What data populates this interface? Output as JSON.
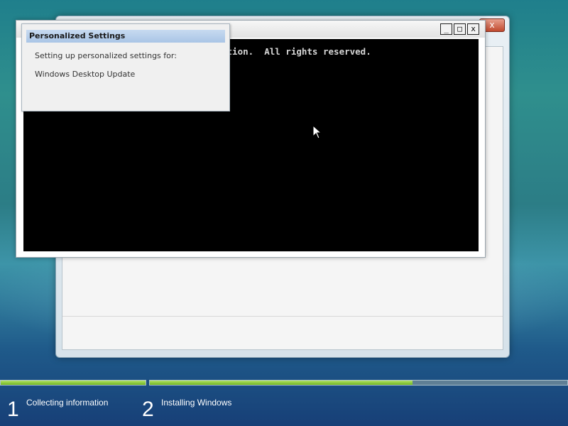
{
  "console": {
    "line1": "ation.  All rights reserved."
  },
  "cmd_window": {
    "minimize_label": "_",
    "maximize_label": "□",
    "close_label": "x"
  },
  "setup_window": {
    "close_label": "x"
  },
  "personalized_settings": {
    "title": "Personalized Settings",
    "line1": "Setting up personalized settings for:",
    "line2": "Windows Desktop Update"
  },
  "steps": [
    {
      "number": "1",
      "label": "Collecting information",
      "progress": 1.0
    },
    {
      "number": "2",
      "label": "Installing Windows",
      "progress": 0.63
    }
  ],
  "colors": {
    "progress_fill": "#7ec32a",
    "console_bg": "#000000",
    "dialog_title": "#b8d0ec"
  },
  "icons": [
    "mouse-pointer-icon"
  ]
}
